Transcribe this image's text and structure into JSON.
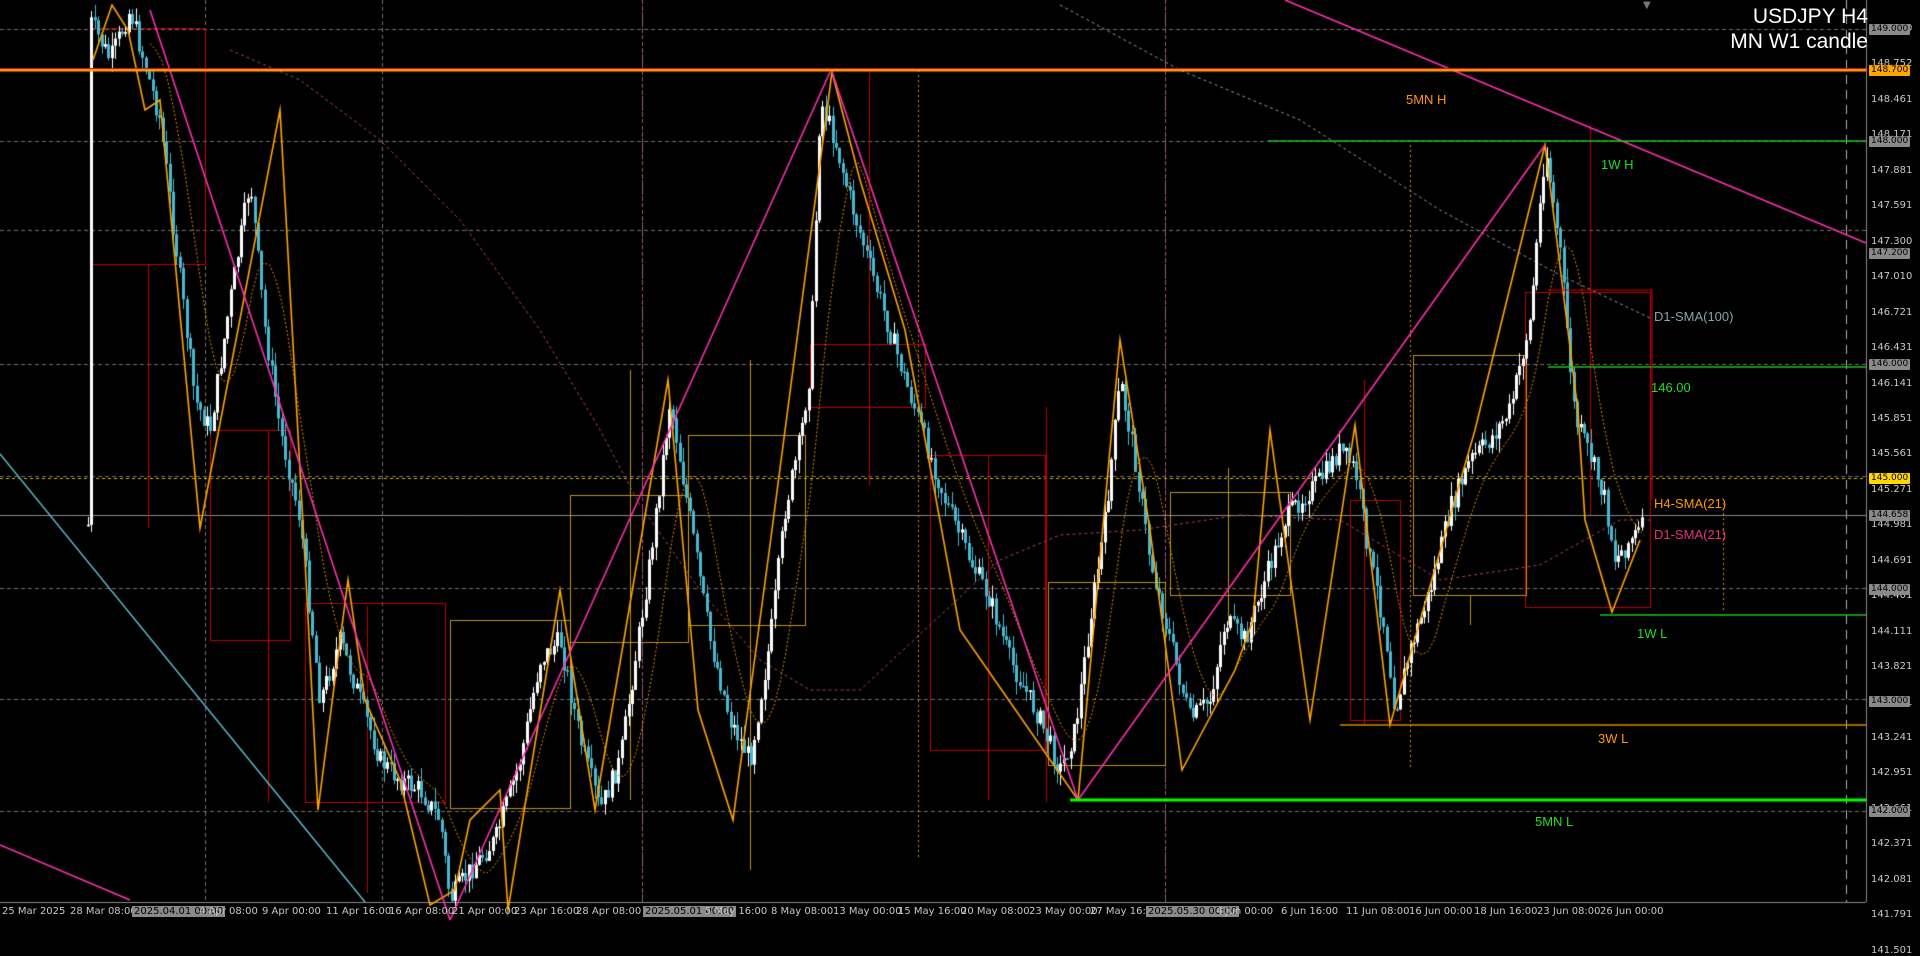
{
  "header": {
    "symbol_timeframe": "USDJPY H4",
    "subtitle": "MN W1 candle"
  },
  "annotations": {
    "five_mn_h": "5MN H",
    "one_w_h": "1W H",
    "d1_sma100": "D1-SMA(100)",
    "level_146": "146.00",
    "h4_sma21": "H4-SMA(21)",
    "d1_sma21": "D1-SMA(21)",
    "one_w_l": "1W L",
    "three_w_l": "3W L",
    "five_mn_l": "5MN L"
  },
  "y_axis": {
    "ticks": [
      "149.000",
      "148.752",
      "148.461",
      "148.171",
      "147.881",
      "147.591",
      "147.300",
      "147.010",
      "146.721",
      "146.431",
      "146.141",
      "145.851",
      "145.561",
      "145.271",
      "144.981",
      "144.691",
      "144.401",
      "144.111",
      "143.821",
      "143.531",
      "143.241",
      "142.951",
      "142.661",
      "142.371",
      "142.081",
      "141.791",
      "141.501"
    ],
    "tags": [
      {
        "text": "149.000",
        "color": "#8a8a8a"
      },
      {
        "text": "148.700",
        "color": "#ffa500"
      },
      {
        "text": "148.000",
        "color": "#8a8a8a"
      },
      {
        "text": "147.200",
        "color": "#8a8a8a"
      },
      {
        "text": "146.000",
        "color": "#8a8a8a"
      },
      {
        "text": "145.000",
        "color": "#ffd700"
      },
      {
        "text": "144.658",
        "color": "#8a8a8a"
      },
      {
        "text": "144.000",
        "color": "#8a8a8a"
      },
      {
        "text": "143.000",
        "color": "#8a8a8a"
      },
      {
        "text": "142.000",
        "color": "#8a8a8a"
      }
    ]
  },
  "x_axis": {
    "ticks": [
      "25 Mar 2025",
      "28 Mar 08:00",
      "2025.04.01 00:00",
      "4 Apr 08:00",
      "9 Apr 00:00",
      "11 Apr 16:00",
      "16 Apr 08:00",
      "21 Apr 00:00",
      "23 Apr 16:00",
      "28 Apr 08:00",
      "2025.05.01 00:00",
      "5 May 16:00",
      "8 May 08:00",
      "13 May 00:00",
      "15 May 16:00",
      "20 May 08:00",
      "23 May 00:00",
      "27 May 16:00",
      "2025.05.30 00:00",
      "4 Jun 00:00",
      "6 Jun 16:00",
      "11 Jun 08:00",
      "16 Jun 00:00",
      "18 Jun 16:00",
      "23 Jun 08:00",
      "26 Jun 00:00"
    ],
    "highlighted": [
      "2025.04.01 00:00",
      "2025.05.01 00:00",
      "2025.05.30 00:00"
    ]
  },
  "colors": {
    "background": "#000000",
    "candle_up": "#ffffff",
    "candle_down": "#4ab8d0",
    "zigzag": "#ffa500",
    "trendline": "#ff2fb0",
    "five_mn_h_line": "#ffa500",
    "five_mn_l_line": "#00ff00",
    "week_line": "#1fbf1f",
    "grid": "#6f6f6f",
    "mn_box": "#d00000",
    "w1_box": "#d4a017"
  },
  "chart_data": {
    "type": "candlestick",
    "symbol": "USDJPY",
    "timeframe": "H4",
    "ylim": [
      141.35,
      149.15
    ],
    "price_levels": {
      "five_mn_h": 148.65,
      "one_w_h": 148.0,
      "level_146": 146.0,
      "h4_sma21": 144.97,
      "d1_sma21": 144.68,
      "one_w_l": 143.82,
      "three_w_l": 142.8,
      "five_mn_l": 142.1,
      "current_price": 144.658
    },
    "zigzag_points": [
      [
        "28 Mar",
        148.95
      ],
      [
        "31 Mar",
        149.1
      ],
      [
        "2 Apr",
        148.6
      ],
      [
        "3 Apr",
        147.9
      ],
      [
        "4 Apr",
        144.9
      ],
      [
        "7 Apr",
        147.5
      ],
      [
        "8 Apr",
        148.2
      ],
      [
        "9 Apr",
        145.9
      ],
      [
        "10 Apr",
        144.3
      ],
      [
        "11 Apr",
        142.2
      ],
      [
        "14 Apr",
        143.3
      ],
      [
        "16 Apr",
        142.4
      ],
      [
        "18 Apr",
        141.5
      ],
      [
        "21 Apr",
        140.9
      ],
      [
        "22 Apr",
        141.4
      ],
      [
        "23 Apr",
        143.5
      ],
      [
        "25 Apr",
        143.9
      ],
      [
        "29 Apr",
        141.4
      ],
      [
        "1 May",
        145.9
      ],
      [
        "6 May",
        142.6
      ],
      [
        "8 May",
        145.1
      ],
      [
        "12 May",
        148.6
      ],
      [
        "14 May",
        146.4
      ],
      [
        "21 May",
        143.5
      ],
      [
        "23 May",
        142.1
      ],
      [
        "28 May",
        145.2
      ],
      [
        "30 May",
        143.8
      ],
      [
        "2 Jun",
        142.6
      ],
      [
        "5 Jun",
        144.6
      ],
      [
        "10 Jun",
        145.0
      ],
      [
        "11 Jun",
        144.1
      ],
      [
        "12 Jun",
        142.8
      ],
      [
        "17 Jun",
        144.9
      ],
      [
        "20 Jun",
        145.6
      ],
      [
        "23 Jun",
        148.0
      ],
      [
        "24 Jun",
        145.7
      ],
      [
        "25 Jun",
        144.5
      ],
      [
        "26 Jun",
        143.8
      ],
      [
        "27 Jun",
        144.5
      ]
    ]
  }
}
